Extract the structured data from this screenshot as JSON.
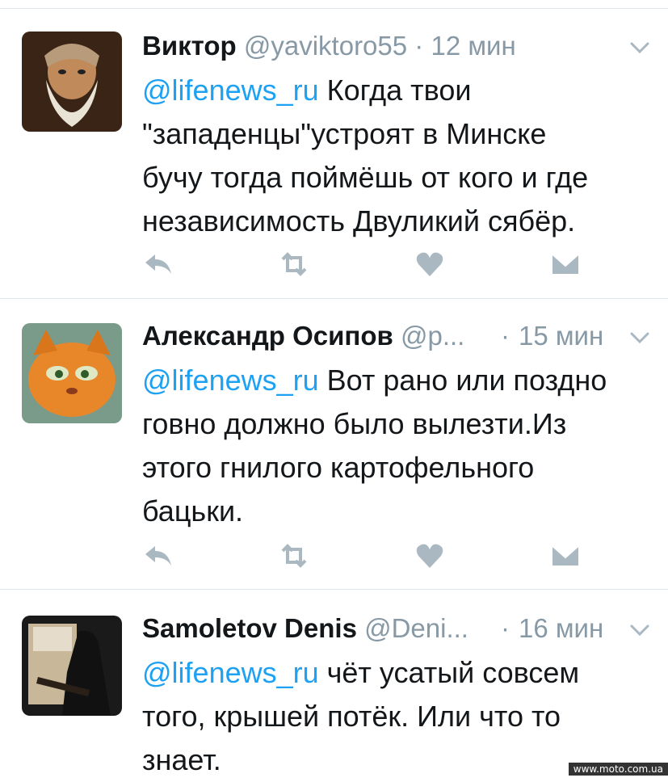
{
  "tweets": [
    {
      "name": "Виктор",
      "handle": "@yaviktoro55",
      "separator": "·",
      "time": "12 мин",
      "mention": "@lifenews_ru",
      "text_lines": [
        " Когда твои",
        "\"западенцы\"устроят в Минске",
        "бучу тогда поймёшь от кого и где",
        "независимость Двуликий сябёр."
      ],
      "avatar": "old-man-beard-avatar"
    },
    {
      "name": "Александр Осипов",
      "handle": "@p...",
      "separator": "·",
      "time": "15 мин",
      "mention": "@lifenews_ru",
      "text_lines": [
        " Вот рано или поздно",
        "говно должно было вылезти.Из",
        "этого гнилого картофельного",
        "бацьки."
      ],
      "avatar": "orange-cat-avatar"
    },
    {
      "name": "Samoletov Denis",
      "handle": "@Deni...",
      "separator": "·",
      "time": "16 мин",
      "mention": "@lifenews_ru",
      "text_lines": [
        " чёт усатый совсем",
        "того, крышей потёк. Или что то",
        "знает."
      ],
      "avatar": "guitarist-silhouette-avatar"
    }
  ],
  "icons": [
    "reply-icon",
    "retweet-icon",
    "like-icon",
    "message-icon",
    "chevron-down-icon"
  ],
  "colors": {
    "link": "#1da1f2",
    "muted": "#8899a6",
    "divider": "#e1e8ed"
  },
  "watermark": "www.moto.com.ua"
}
